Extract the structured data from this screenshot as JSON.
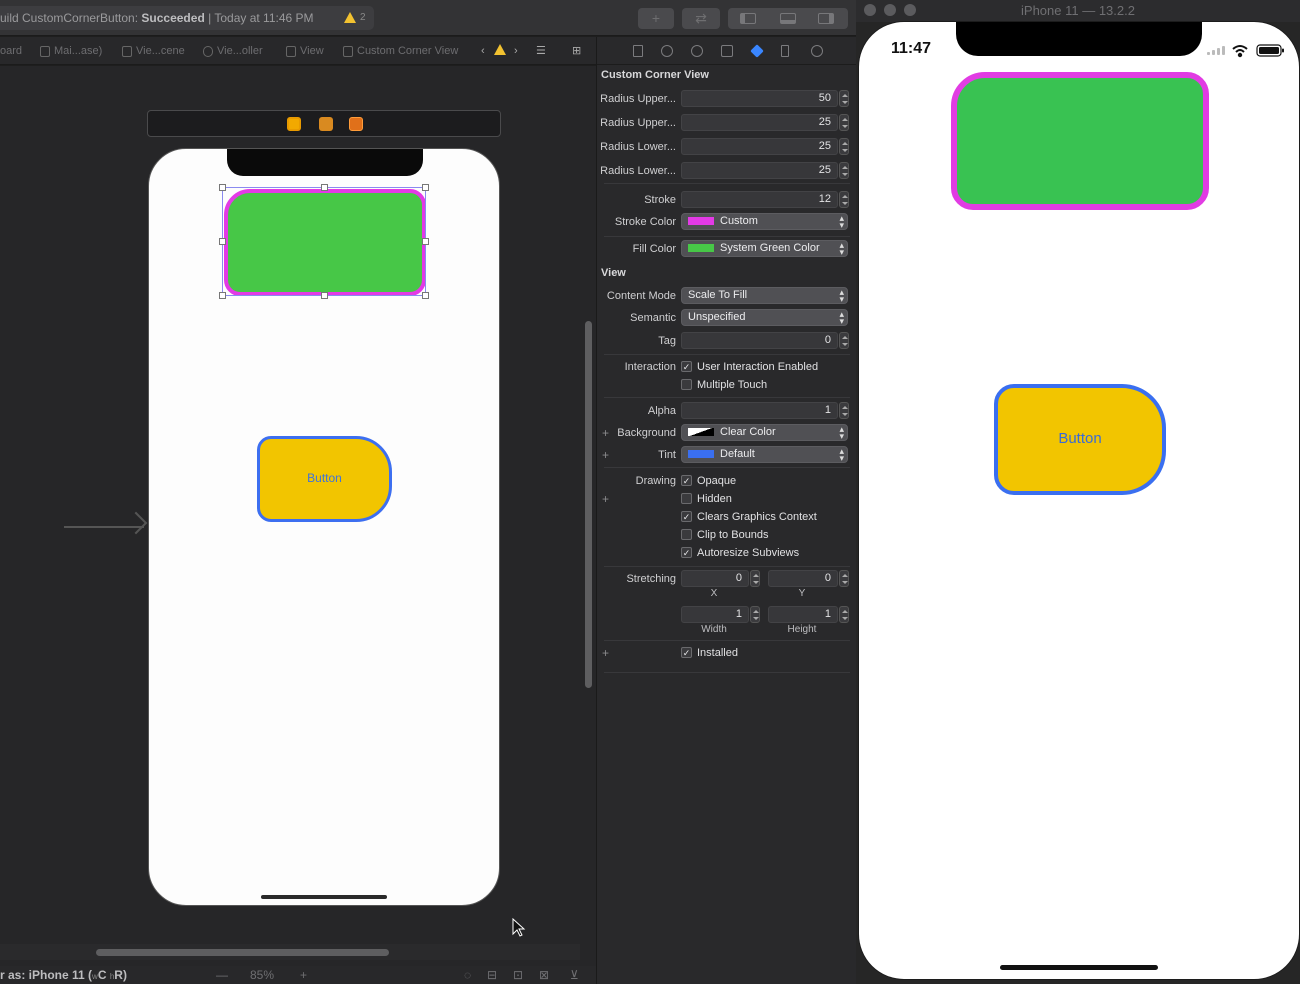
{
  "toolbar": {
    "status_prefix": "uild CustomCornerButton: ",
    "status_result": "Succeeded",
    "status_suffix": " | Today at 11:46 PM",
    "warning_count": "2"
  },
  "jumpbar": {
    "segments": [
      "oard",
      "Mai...ase)",
      "Vie...cene",
      "Vie...oller",
      "View",
      "Custom Corner View"
    ]
  },
  "canvas": {
    "button_label": "Button"
  },
  "bottom_bar": {
    "view_as": "r as: iPhone 11 (",
    "size_class_w": "w",
    "size_class_c": "C ",
    "size_class_h": "h",
    "size_class_r": "R)",
    "zoom": "85%"
  },
  "inspector": {
    "custom_section": "Custom Corner View",
    "radius_rows": [
      {
        "label": "Radius Upper...",
        "value": "50"
      },
      {
        "label": "Radius Upper...",
        "value": "25"
      },
      {
        "label": "Radius Lower...",
        "value": "25"
      },
      {
        "label": "Radius Lower...",
        "value": "25"
      }
    ],
    "stroke_label": "Stroke",
    "stroke_value": "12",
    "stroke_color_label": "Stroke Color",
    "stroke_color_value": "Custom",
    "stroke_color_hex": "#e33ae6",
    "fill_color_label": "Fill Color",
    "fill_color_value": "System Green Color",
    "fill_color_hex": "#47c747",
    "view_section": "View",
    "content_mode_label": "Content Mode",
    "content_mode_value": "Scale To Fill",
    "semantic_label": "Semantic",
    "semantic_value": "Unspecified",
    "tag_label": "Tag",
    "tag_value": "0",
    "interaction_label": "Interaction",
    "user_interaction": "User Interaction Enabled",
    "multiple_touch": "Multiple Touch",
    "alpha_label": "Alpha",
    "alpha_value": "1",
    "background_label": "Background",
    "background_value": "Clear Color",
    "tint_label": "Tint",
    "tint_value": "Default",
    "tint_hex": "#3a6ff0",
    "drawing_label": "Drawing",
    "opaque": "Opaque",
    "hidden": "Hidden",
    "clears_graphics": "Clears Graphics Context",
    "clip_to_bounds": "Clip to Bounds",
    "autoresize": "Autoresize Subviews",
    "stretching_label": "Stretching",
    "stretch_x": "0",
    "stretch_y": "0",
    "x_label": "X",
    "y_label": "Y",
    "stretch_w": "1",
    "stretch_h": "1",
    "width_label": "Width",
    "height_label": "Height",
    "installed": "Installed"
  },
  "simulator": {
    "title": "iPhone 11 — 13.2.2",
    "time": "11:47",
    "button_label": "Button"
  }
}
